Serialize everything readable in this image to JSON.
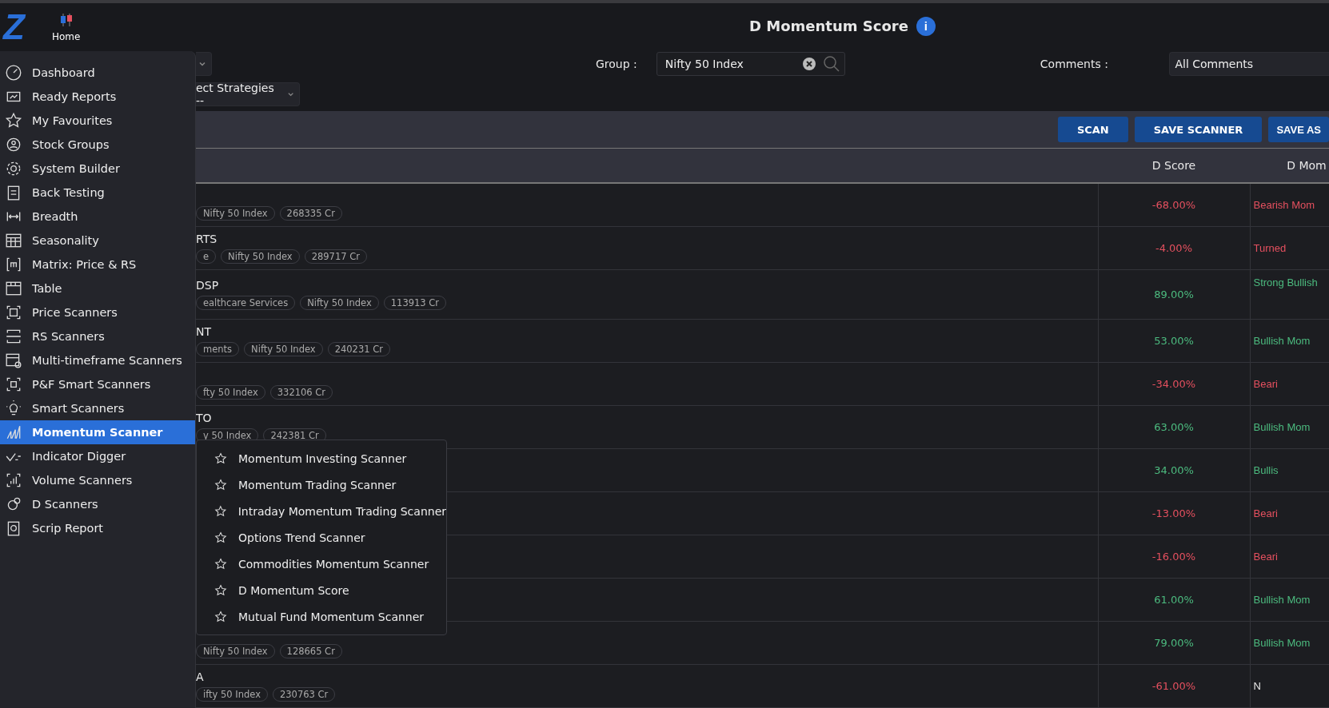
{
  "brand": {
    "logo": "Z",
    "home": "Home"
  },
  "title": "D Momentum Score",
  "info": "i",
  "filters": {
    "group_label": "Group :",
    "group_value": "Nifty 50 Index",
    "comments_label": "Comments :",
    "comments_value": "All Comments",
    "strategies_value": "ect Strategies --"
  },
  "buttons": [
    "SCAN",
    "SAVE SCANNER",
    "SAVE AS"
  ],
  "table": {
    "columns": [
      "",
      "D Score",
      "D Mom"
    ],
    "rows": [
      {
        "name": "",
        "tags": [
          "Nifty 50 Index",
          "268335 Cr"
        ],
        "score": {
          "text": "-68.00%",
          "color": "#e5505f"
        },
        "momentum": {
          "text": "Bearish Mom",
          "color": "#e5505f"
        }
      },
      {
        "name": "RTS",
        "tags": [
          "e",
          "Nifty 50 Index",
          "289717 Cr"
        ],
        "score": {
          "text": "-4.00%",
          "color": "#e5505f"
        },
        "momentum": {
          "text": "Turned",
          "color": "#e5505f"
        }
      },
      {
        "name": "DSP",
        "tags": [
          "ealthcare Services",
          "Nifty 50 Index",
          "113913 Cr"
        ],
        "score": {
          "text": "89.00%",
          "color": "#4cbb7f"
        },
        "momentum": {
          "text": "Strong Bullish",
          "color": "#4cbb7f"
        }
      },
      {
        "name": "NT",
        "tags": [
          "ments",
          "Nifty 50 Index",
          "240231 Cr"
        ],
        "score": {
          "text": "53.00%",
          "color": "#4cbb7f"
        },
        "momentum": {
          "text": "Bullish Mom",
          "color": "#4cbb7f"
        }
      },
      {
        "name": "",
        "tags": [
          "fty 50 Index",
          "332106 Cr"
        ],
        "score": {
          "text": "-34.00%",
          "color": "#e5505f"
        },
        "momentum": {
          "text": "Beari",
          "color": "#e5505f"
        }
      },
      {
        "name": "TO",
        "tags": [
          "y 50 Index",
          "242381 Cr"
        ],
        "score": {
          "text": "63.00%",
          "color": "#4cbb7f"
        },
        "momentum": {
          "text": "Bullish Mom",
          "color": "#4cbb7f"
        }
      },
      {
        "name": "",
        "tags": [],
        "score": {
          "text": "34.00%",
          "color": "#4cbb7f"
        },
        "momentum": {
          "text": "Bullis",
          "color": "#4cbb7f"
        }
      },
      {
        "name": "",
        "tags": [],
        "score": {
          "text": "-13.00%",
          "color": "#e5505f"
        },
        "momentum": {
          "text": "Beari",
          "color": "#e5505f"
        }
      },
      {
        "name": "",
        "tags": [],
        "score": {
          "text": "-16.00%",
          "color": "#e5505f"
        },
        "momentum": {
          "text": "Beari",
          "color": "#e5505f"
        }
      },
      {
        "name": "",
        "tags": [],
        "score": {
          "text": "61.00%",
          "color": "#4cbb7f"
        },
        "momentum": {
          "text": "Bullish Mom",
          "color": "#4cbb7f"
        }
      },
      {
        "name": "",
        "tags": [
          "Nifty 50 Index",
          "128665 Cr"
        ],
        "score": {
          "text": "79.00%",
          "color": "#4cbb7f"
        },
        "momentum": {
          "text": "Bullish Mom",
          "color": "#4cbb7f"
        }
      },
      {
        "name": "A",
        "tags": [
          "ifty 50 Index",
          "230763 Cr"
        ],
        "score": {
          "text": "-61.00%",
          "color": "#e5505f"
        },
        "momentum": {
          "text": "N",
          "color": "#e8e8e8"
        }
      }
    ]
  },
  "sidebar": {
    "items": [
      {
        "label": "Dashboard",
        "selected": false
      },
      {
        "label": "Ready Reports",
        "selected": false
      },
      {
        "label": "My Favourites",
        "selected": false
      },
      {
        "label": "Stock Groups",
        "selected": false
      },
      {
        "label": "System Builder",
        "selected": false
      },
      {
        "label": "Back Testing",
        "selected": false
      },
      {
        "label": "Breadth",
        "selected": false
      },
      {
        "label": "Seasonality",
        "selected": false
      },
      {
        "label": "Matrix: Price & RS",
        "selected": false
      },
      {
        "label": "Table",
        "selected": false
      },
      {
        "label": "Price Scanners",
        "selected": false
      },
      {
        "label": "RS Scanners",
        "selected": false
      },
      {
        "label": "Multi-timeframe Scanners",
        "selected": false
      },
      {
        "label": "P&F Smart Scanners",
        "selected": false
      },
      {
        "label": "Smart Scanners",
        "selected": false
      },
      {
        "label": "Momentum Scanner",
        "selected": true
      },
      {
        "label": "Indicator Digger",
        "selected": false
      },
      {
        "label": "Volume Scanners",
        "selected": false
      },
      {
        "label": "D Scanners",
        "selected": false
      },
      {
        "label": "Scrip Report",
        "selected": false
      }
    ]
  },
  "submenu": {
    "items": [
      "Momentum Investing Scanner",
      "Momentum Trading Scanner",
      "Intraday Momentum Trading Scanner",
      "Options Trend Scanner",
      "Commodities Momentum Scanner",
      "D Momentum Score",
      "Mutual Fund Momentum Scanner"
    ]
  }
}
